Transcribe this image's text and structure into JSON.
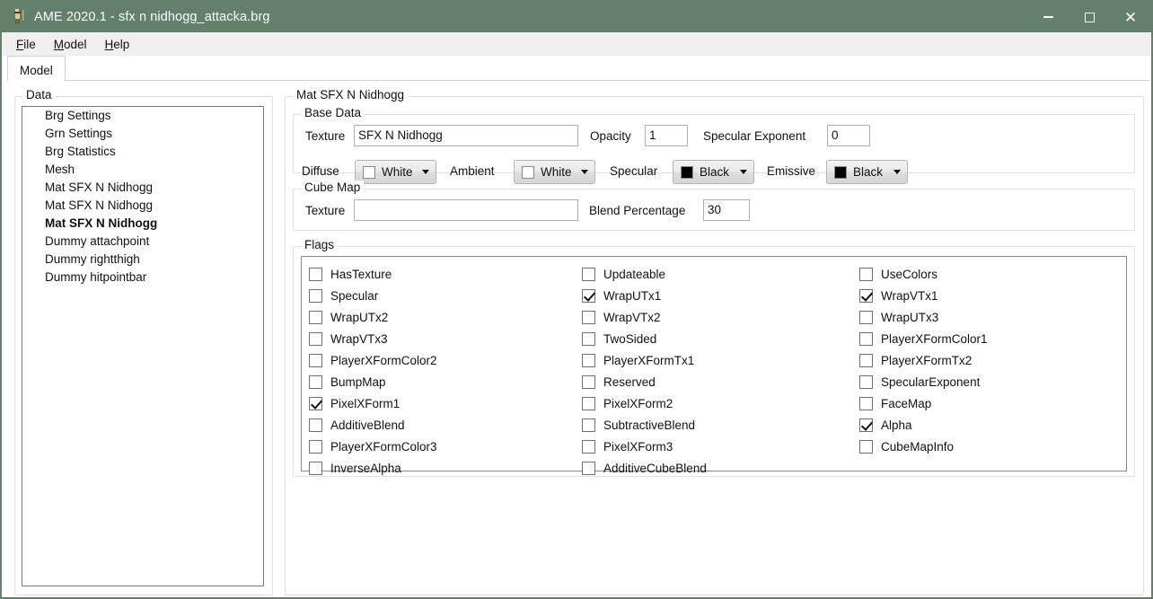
{
  "window": {
    "title": "AME 2020.1 - sfx n nidhogg_attacka.brg",
    "icon": "app-character-icon",
    "titlebar_color": "#62806a",
    "controls": {
      "minimize": "minimize-icon",
      "maximize": "maximize-icon",
      "close": "close-icon"
    }
  },
  "menubar": {
    "items": [
      {
        "label": "File",
        "accel": "F"
      },
      {
        "label": "Model",
        "accel": "M"
      },
      {
        "label": "Help",
        "accel": "H"
      }
    ]
  },
  "tabs": [
    {
      "label": "Model",
      "active": true
    }
  ],
  "data_panel": {
    "title": "Data",
    "items": [
      {
        "label": "Brg Settings",
        "selected": false
      },
      {
        "label": "Grn Settings",
        "selected": false
      },
      {
        "label": "Brg Statistics",
        "selected": false
      },
      {
        "label": "Mesh",
        "selected": false
      },
      {
        "label": "Mat SFX N Nidhogg",
        "selected": false
      },
      {
        "label": "Mat SFX N Nidhogg",
        "selected": false
      },
      {
        "label": "Mat SFX N Nidhogg",
        "selected": true
      },
      {
        "label": "Dummy attachpoint",
        "selected": false
      },
      {
        "label": "Dummy rightthigh",
        "selected": false
      },
      {
        "label": "Dummy hitpointbar",
        "selected": false
      }
    ]
  },
  "material": {
    "title": "Mat SFX N Nidhogg",
    "base_data": {
      "title": "Base Data",
      "texture_label": "Texture",
      "texture_value": "SFX N Nidhogg",
      "opacity_label": "Opacity",
      "opacity_value": "1",
      "specular_exponent_label": "Specular Exponent",
      "specular_exponent_value": "0",
      "diffuse_label": "Diffuse",
      "diffuse_value": "White",
      "diffuse_color": "#ffffff",
      "ambient_label": "Ambient",
      "ambient_value": "White",
      "ambient_color": "#ffffff",
      "specular_label": "Specular",
      "specular_value": "Black",
      "specular_color": "#000000",
      "emissive_label": "Emissive",
      "emissive_value": "Black",
      "emissive_color": "#000000"
    },
    "cube_map": {
      "title": "Cube Map",
      "texture_label": "Texture",
      "texture_value": "",
      "blend_label": "Blend Percentage",
      "blend_value": "30"
    },
    "flags": {
      "title": "Flags",
      "columns": [
        [
          {
            "label": "HasTexture",
            "checked": false
          },
          {
            "label": "Specular",
            "checked": false
          },
          {
            "label": "WrapUTx2",
            "checked": false
          },
          {
            "label": "WrapVTx3",
            "checked": false
          },
          {
            "label": "PlayerXFormColor2",
            "checked": false
          },
          {
            "label": "BumpMap",
            "checked": false
          },
          {
            "label": "PixelXForm1",
            "checked": true
          },
          {
            "label": "AdditiveBlend",
            "checked": false
          },
          {
            "label": "PlayerXFormColor3",
            "checked": false
          },
          {
            "label": "InverseAlpha",
            "checked": false
          }
        ],
        [
          {
            "label": "Updateable",
            "checked": false
          },
          {
            "label": "WrapUTx1",
            "checked": true
          },
          {
            "label": "WrapVTx2",
            "checked": false
          },
          {
            "label": "TwoSided",
            "checked": false
          },
          {
            "label": "PlayerXFormTx1",
            "checked": false
          },
          {
            "label": "Reserved",
            "checked": false
          },
          {
            "label": "PixelXForm2",
            "checked": false
          },
          {
            "label": "SubtractiveBlend",
            "checked": false
          },
          {
            "label": "PixelXForm3",
            "checked": false
          },
          {
            "label": "AdditiveCubeBlend",
            "checked": false
          }
        ],
        [
          {
            "label": "UseColors",
            "checked": false
          },
          {
            "label": "WrapVTx1",
            "checked": true
          },
          {
            "label": "WrapUTx3",
            "checked": false
          },
          {
            "label": "PlayerXFormColor1",
            "checked": false
          },
          {
            "label": "PlayerXFormTx2",
            "checked": false
          },
          {
            "label": "SpecularExponent",
            "checked": false
          },
          {
            "label": "FaceMap",
            "checked": false
          },
          {
            "label": "Alpha",
            "checked": true
          },
          {
            "label": "CubeMapInfo",
            "checked": false
          }
        ]
      ]
    }
  }
}
